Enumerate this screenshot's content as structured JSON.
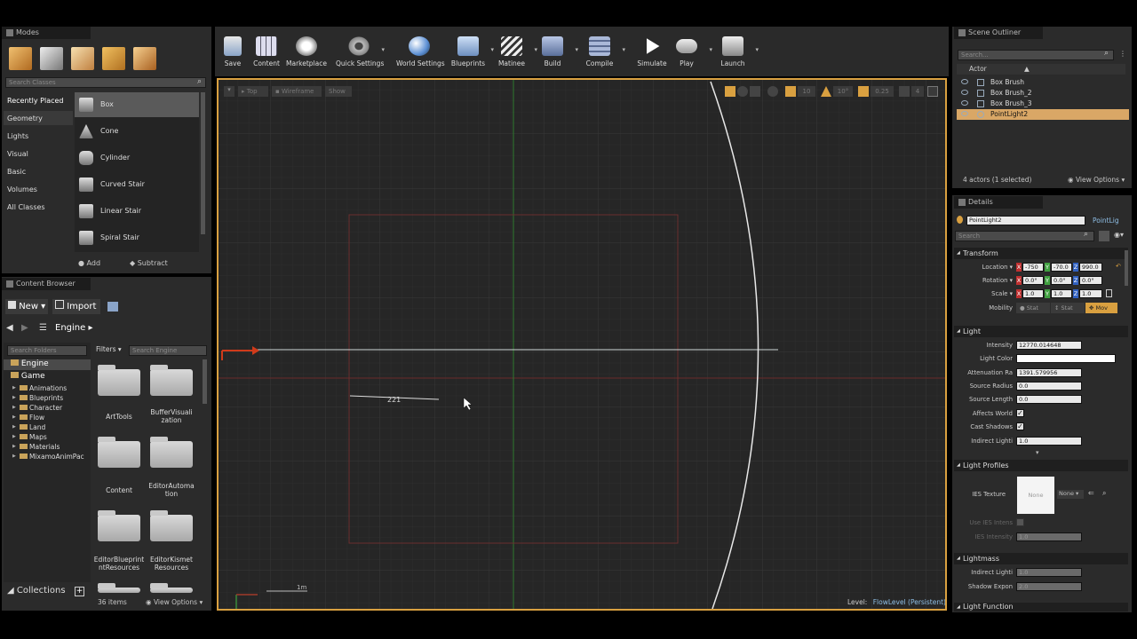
{
  "modes": {
    "title": "Modes",
    "search_placeholder": "Search Classes",
    "categories": [
      "Recently Placed",
      "Geometry",
      "Lights",
      "Visual",
      "Basic",
      "Volumes",
      "All Classes"
    ],
    "items": [
      "Box",
      "Cone",
      "Cylinder",
      "Curved Stair",
      "Linear Stair",
      "Spiral Stair"
    ],
    "add_label": "Add",
    "subtract_label": "Subtract"
  },
  "toolbar": {
    "buttons": [
      "Save",
      "Content",
      "Marketplace",
      "Quick Settings",
      "World Settings",
      "Blueprints",
      "Matinee",
      "Build",
      "Compile",
      "Simulate",
      "Play",
      "Launch"
    ]
  },
  "viewport": {
    "top_label": "Top",
    "wireframe_label": "Wireframe",
    "show_label": "Show",
    "grid_snap": "10",
    "rot_snap": "10°",
    "scale_snap": "0.25",
    "camera_speed": "4",
    "measure_label": "221",
    "scale_label": "1m",
    "level_prefix": "Level:",
    "level_name": "FlowLevel (Persistent)",
    "colors": {
      "accent": "#d9a040",
      "grid_x": "#8b2b2b",
      "grid_y": "#2f7a2f"
    }
  },
  "content_browser": {
    "title": "Content Browser",
    "new_label": "New",
    "import_label": "Import",
    "path_root": "Engine",
    "folders_search": "Search Folders",
    "filters_label": "Filters",
    "search_placeholder": "Search Engine",
    "tree_root": "Engine",
    "tree_game": "Game",
    "tree_items": [
      "Animations",
      "Blueprints",
      "Character",
      "Flow",
      "Land",
      "Maps",
      "Materials",
      "MixamoAnimPac"
    ],
    "assets": [
      "ArtTools",
      "BufferVisuali zation",
      "Content",
      "EditorAutoma tion",
      "EditorBlueprint ntResources",
      "EditorKismet Resources"
    ],
    "item_count": "36 items",
    "view_options": "View Options",
    "collections_label": "Collections"
  },
  "outliner": {
    "title": "Scene Outliner",
    "search_placeholder": "Search...",
    "column": "Actor",
    "actors": [
      "Box Brush",
      "Box Brush_2",
      "Box Brush_3",
      "PointLight2"
    ],
    "status": "4 actors (1 selected)",
    "view_options": "View Options"
  },
  "details": {
    "title": "Details",
    "name": "PointLight2",
    "class_label": "PointLig",
    "search_placeholder": "Search",
    "transform_header": "Transform",
    "location_label": "Location",
    "location": [
      "-750",
      "-70.0",
      "990.0"
    ],
    "rotation_label": "Rotation",
    "rotation": [
      "0.0°",
      "0.0°",
      "0.0°"
    ],
    "scale_label": "Scale",
    "scale": [
      "1.0",
      "1.0",
      "1.0"
    ],
    "mobility_label": "Mobility",
    "mobility_options": [
      "Stat",
      "Stat",
      "Mov"
    ],
    "light_header": "Light",
    "intensity_label": "Intensity",
    "intensity": "12770.014648",
    "light_color_label": "Light Color",
    "attenuation_label": "Attenuation Ra",
    "attenuation": "1391.579956",
    "source_radius_label": "Source Radius",
    "source_radius": "0.0",
    "source_length_label": "Source Length",
    "source_length": "0.0",
    "affects_world_label": "Affects World",
    "cast_shadows_label": "Cast Shadows",
    "indirect_label": "Indirect Lighti",
    "indirect": "1.0",
    "profiles_header": "Light Profiles",
    "ies_label": "IES Texture",
    "ies_value": "None",
    "ies_thumb": "None",
    "use_ies_label": "Use IES Intens",
    "ies_intensity_label": "IES Intensity",
    "ies_intensity": "1.0",
    "lightmass_header": "Lightmass",
    "lm_indirect_label": "Indirect Lighti",
    "lm_indirect": "1.0",
    "shadow_exp_label": "Shadow Expon",
    "shadow_exp": "2.0",
    "function_header": "Light Function"
  }
}
